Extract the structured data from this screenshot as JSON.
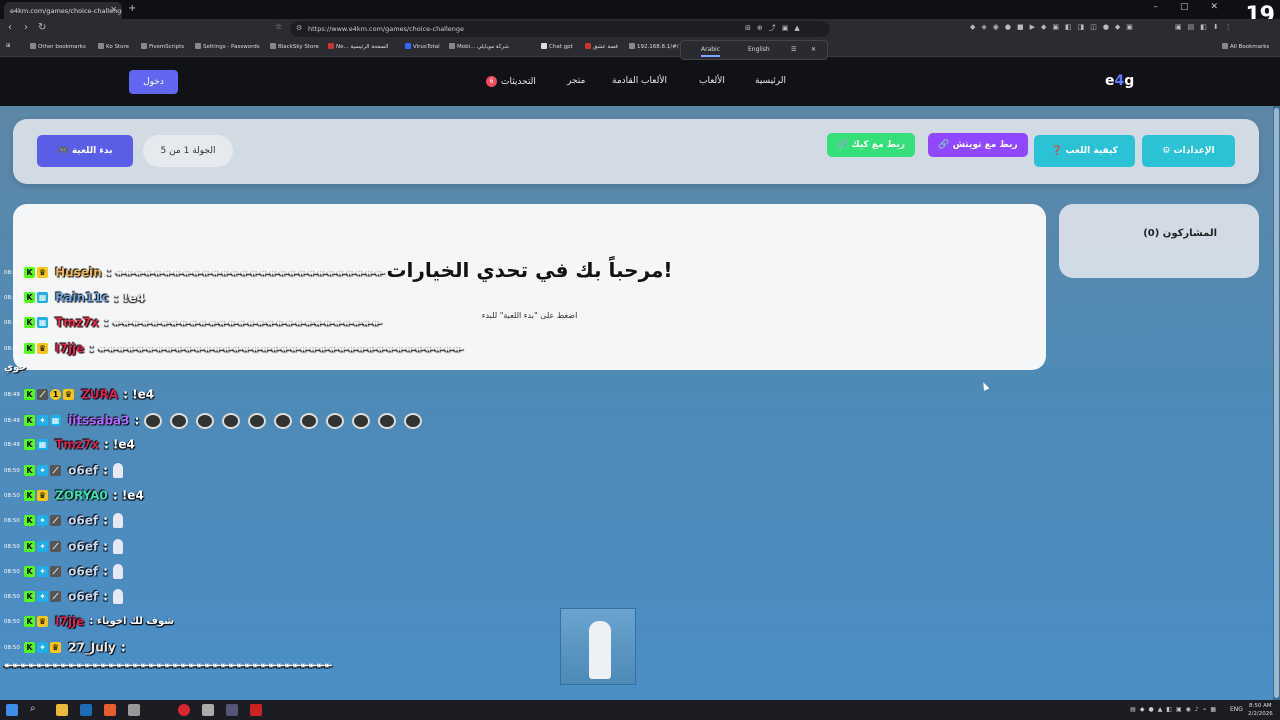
{
  "browser": {
    "tab_title": "e4km.com/games/choice-challenge",
    "tab_close": "✕",
    "new_tab": "+",
    "url": "https://www.e4km.com/games/choice-challenge",
    "overlay_number": "19",
    "bookmarks": [
      "Other bookmarks",
      "Ko Store",
      "FivemScripts",
      "Settings - Passwords",
      "BlackSky Store",
      "Ne... الصفحة الرئيسية",
      "VirusTotal",
      "Mobi... شركة موبايلي",
      "Chat gpt",
      "قصة عشق",
      "192.168.8.1/#/"
    ],
    "bookmarks_right": "All Bookmarks",
    "translate_popup": {
      "lang_a": "Arabic",
      "lang_b": "English"
    }
  },
  "site": {
    "logo_prefix": "e",
    "logo_digit": "4",
    "logo_suffix": "g",
    "nav": {
      "home": "الرئيسية",
      "games": "الألعاب",
      "upcoming": "الألعاب القادمة",
      "store": "متجر",
      "updates": "التحديثات",
      "updates_badge": "6"
    },
    "login": "دخول"
  },
  "controls": {
    "start": "🎮 بدء اللعبة",
    "round": "الجولة 1 من 5",
    "kick": "🔗 ربط مع كيك",
    "twitch": "🔗 ربط مع تويتش",
    "how_to_play": "❓ كيفية اللعب",
    "settings": "⚙ الإعدادات"
  },
  "welcome": {
    "title": "مرحباً بك في تحدي الخيارات!",
    "subtitle": "اضغط على \"بدء اللعبة\" للبدء"
  },
  "participants": {
    "label": "المشاركون (0)"
  },
  "chat": {
    "arabic_note": "جوي",
    "lines": [
      {
        "time": "08:48",
        "user": "Husein",
        "color": "#f0b860",
        "msg": ": ⯬⯬⯬⯬⯬⯬⯬⯬⯬⯬⯬⯬⯬⯬⯬⯬⯬⯬⯬⯬⯬⯬⯬⯬⯬⯬⯬⯬"
      },
      {
        "time": "08:48",
        "user": "Rain11c",
        "color": "#6fa8dc",
        "msg": ": !e4"
      },
      {
        "time": "08:48",
        "user": "Tmz7x",
        "color": "#e0304a",
        "msg": ": ⯬⯬⯬⯬⯬⯬⯬⯬⯬⯬⯬⯬⯬⯬⯬⯬⯬⯬⯬⯬⯬⯬⯬⯬⯬⯬⯬⯬"
      },
      {
        "time": "08:48",
        "user": "I7jje",
        "color": "#d6254f",
        "msg": ": ⯬⯬⯬⯬⯬⯬⯬⯬⯬⯬⯬⯬⯬⯬⯬⯬⯬⯬⯬⯬⯬⯬⯬⯬⯬⯬⯬⯬⯬⯬⯬⯬⯬⯬⯬⯬⯬⯬"
      },
      {
        "time": "08:49",
        "user": "ZURA",
        "color": "#d6254f",
        "msg": ": !e4"
      },
      {
        "time": "08:49",
        "user": "iitssaba3",
        "color": "#b36bff",
        "msg": ":"
      },
      {
        "time": "08:49",
        "user": "Tmz7x",
        "color": "#d6254f",
        "msg": ": !e4"
      },
      {
        "time": "08:50",
        "user": "o6ef",
        "color": "#c7d8f2",
        "msg": ":"
      },
      {
        "time": "08:50",
        "user": "ZORYA0",
        "color": "#3fe0b0",
        "msg": ": !e4"
      },
      {
        "time": "08:50",
        "user": "o6ef",
        "color": "#c7d8f2",
        "msg": ":"
      },
      {
        "time": "08:50",
        "user": "o6ef",
        "color": "#c7d8f2",
        "msg": ":"
      },
      {
        "time": "08:50",
        "user": "o6ef",
        "color": "#c7d8f2",
        "msg": ":"
      },
      {
        "time": "08:50",
        "user": "o6ef",
        "color": "#c7d8f2",
        "msg": ":"
      },
      {
        "time": "08:50",
        "user": "I7jje",
        "color": "#d6254f",
        "msg": ": شوف لك اخوياء"
      },
      {
        "time": "08:50",
        "user": "27_July",
        "color": "#e8e8e8",
        "msg": ":"
      }
    ],
    "bottom_line": "⯬⯬⯬⯬⯬⯬⯬⯬⯬⯬⯬⯬⯬⯬⯬⯬⯬⯬⯬⯬⯬⯬⯬⯬⯬⯬⯬⯬⯬⯬⯬⯬⯬⯬⯬⯬⯬⯬⯬⯬⯬"
  },
  "taskbar": {
    "lang": "ENG",
    "time": "8:50 AM",
    "date": "2/2/2026"
  }
}
